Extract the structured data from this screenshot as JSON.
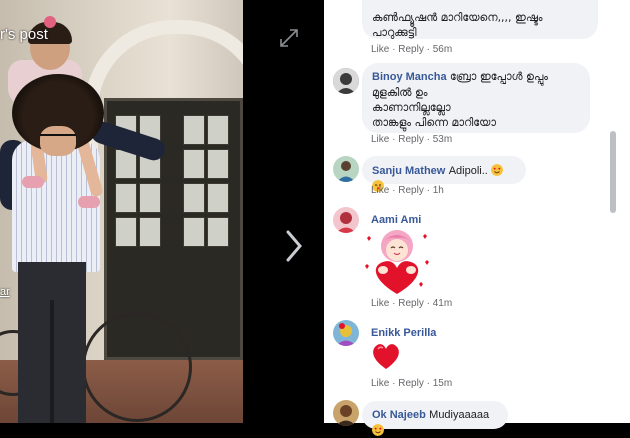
{
  "photo": {
    "caption": "r's post",
    "caption2": "ar"
  },
  "controls": {
    "expand_icon": "expand-icon",
    "next_icon": "chevron-right-icon"
  },
  "comments": [
    {
      "author": "",
      "text_lines": [
        "കൺഫ്യൂഷൻ മാറിയേനെ,,,, ഇഷ്ടം",
        "പാറുക്കുട്ടി"
      ],
      "actions": {
        "like": "Like",
        "sep": "·",
        "reply": "Reply",
        "time": "56m"
      }
    },
    {
      "author": "Binoy Mancha",
      "text_lines": [
        "ബ്രോ ഇപ്പോൾ ഉപ്പും",
        "മുളകിൽ ഉം",
        "കാണാനില്ലല്ലോ",
        "താങ്കളും പിന്നെ മാറിയോ"
      ],
      "actions": {
        "like": "Like",
        "sep": "·",
        "reply": "Reply",
        "time": "53m"
      }
    },
    {
      "author": "Sanju Mathew",
      "text": "Adipoli..",
      "actions": {
        "like": "Like",
        "sep": "·",
        "reply": "Reply",
        "time": "1h"
      }
    },
    {
      "author": "Aami Ami",
      "sticker": "heart-hug-sticker",
      "actions": {
        "like": "Like",
        "sep": "·",
        "reply": "Reply",
        "time": "41m"
      }
    },
    {
      "author": "Enikk Perilla",
      "emoji": "red-heart-icon",
      "actions": {
        "like": "Like",
        "sep": "·",
        "reply": "Reply",
        "time": "15m"
      }
    },
    {
      "author": "Ok Najeeb",
      "text": "Mudiyaaaaa",
      "actions": {}
    }
  ],
  "colors": {
    "link": "#385898",
    "meta": "#65676b",
    "bubble": "#f0f2f5",
    "heart": "#e3122b",
    "emoji_face": "#f7c23b"
  }
}
